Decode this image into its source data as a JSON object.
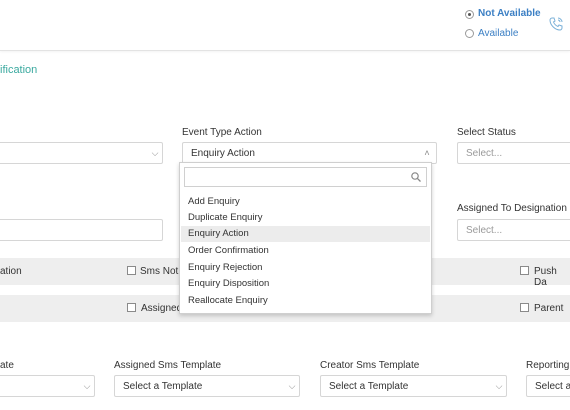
{
  "availability": {
    "options": [
      {
        "label": "Not Available",
        "selected": true
      },
      {
        "label": "Available",
        "selected": false
      }
    ],
    "phone_icon": "phone-call-icon"
  },
  "section": {
    "title_fragment": "ification"
  },
  "fields": {
    "event_type_action": {
      "label": "Event Type Action",
      "value": "Enquiry Action"
    },
    "select_status": {
      "label": "Select Status",
      "placeholder": "Select..."
    },
    "assigned_to_designation": {
      "label": "Assigned To Designation",
      "placeholder": "Select..."
    }
  },
  "band1": {
    "left_fragment": "ation",
    "sms_fragment": "Sms Noti",
    "push_fragment": "Push Da"
  },
  "band2": {
    "assigned_fragment": "Assigned",
    "parent": "Parent"
  },
  "templates": {
    "left_label_fragment": "ate",
    "assigned_sms": {
      "label": "Assigned Sms Template",
      "value": "Select a Template"
    },
    "creator_sms": {
      "label": "Creator Sms Template",
      "value": "Select a Template"
    },
    "reporting": {
      "label": "Reporting",
      "value": "Select a"
    }
  },
  "dropdown": {
    "search_icon": "search-icon",
    "items": [
      {
        "label": "Add Enquiry"
      },
      {
        "label": "Duplicate Enquiry"
      },
      {
        "label": "Enquiry Action",
        "highlighted": true
      },
      {
        "label": "Order Confirmation"
      },
      {
        "label": "Enquiry Rejection"
      },
      {
        "label": "Enquiry Disposition"
      },
      {
        "label": "Reallocate Enquiry"
      }
    ]
  }
}
